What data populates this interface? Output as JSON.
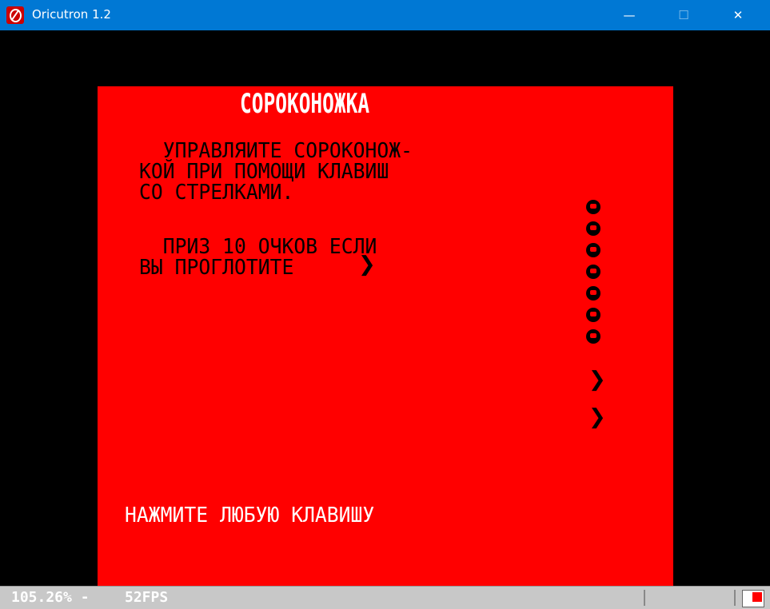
{
  "window": {
    "title": "Oricutron 1.2",
    "minimize_label": "—",
    "maximize_label": "☐",
    "close_label": "✕"
  },
  "screen": {
    "heading": "СОРОКОНОЖКА",
    "paragraph1": "  УПРАВЛЯИТЕ СОРОКОНОЖ-\nКОЙ ПРИ ПОМОЩИ КЛАВИШ\nСО СТРЕЛКАМИ.",
    "paragraph2": "  ПРИЗ 10 ОЧКОВ ЕСЛИ\nВЫ ПРОГЛОТИТЕ",
    "press_key": "НАЖМИТЕ ЛЮБУЮ КЛАВИШУ",
    "centipede_segments": 7,
    "mushrooms": 2,
    "colors": {
      "background": "#ff0000",
      "border": "#000000",
      "heading": "#ffffff",
      "text": "#000000"
    }
  },
  "statusbar": {
    "zoom": "105.26% -",
    "fps": "52FPS"
  }
}
